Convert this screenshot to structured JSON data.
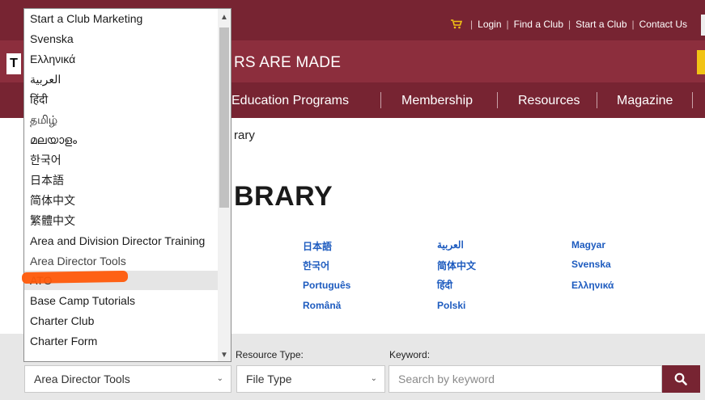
{
  "header": {
    "links": [
      "Login",
      "Find a Club",
      "Start a Club",
      "Contact Us"
    ],
    "logo_letter": "T",
    "tagline": "RS ARE MADE",
    "nav": [
      "Education Programs",
      "Membership",
      "Resources",
      "Magazine"
    ]
  },
  "page": {
    "breadcrumb": "rary",
    "title": "BRARY",
    "languages": [
      [
        "日本語",
        "العربية",
        "Magyar"
      ],
      [
        "한국어",
        "简体中文",
        "Svenska"
      ],
      [
        "Português",
        "हिंदी",
        "Ελληνικά"
      ],
      [
        "Română",
        "Polski",
        ""
      ]
    ]
  },
  "filters": {
    "category_selected": "Area Director Tools",
    "resource_type_label": "Resource Type:",
    "resource_type_value": "File Type",
    "keyword_label": "Keyword:",
    "keyword_placeholder": "Search by keyword"
  },
  "dropdown": {
    "highlighted": "ATO",
    "marked": "Area Director Tools",
    "options": [
      "Start a Club Marketing",
      "Svenska",
      "Ελληνικά",
      "العربية",
      "हिंदी",
      "தமிழ்",
      "മലയാളം",
      "한국어",
      "日本語",
      "简体中文",
      "繁體中文",
      "Area and Division Director Training",
      "Area Director Tools",
      "ATO",
      "Base Camp Tutorials",
      "Charter Club",
      "Charter Form"
    ]
  },
  "colors": {
    "brand_maroon": "#772432",
    "accent_gold": "#f2c314",
    "link_blue": "#1d5bbf",
    "annotation_orange": "#ff5a0a"
  }
}
